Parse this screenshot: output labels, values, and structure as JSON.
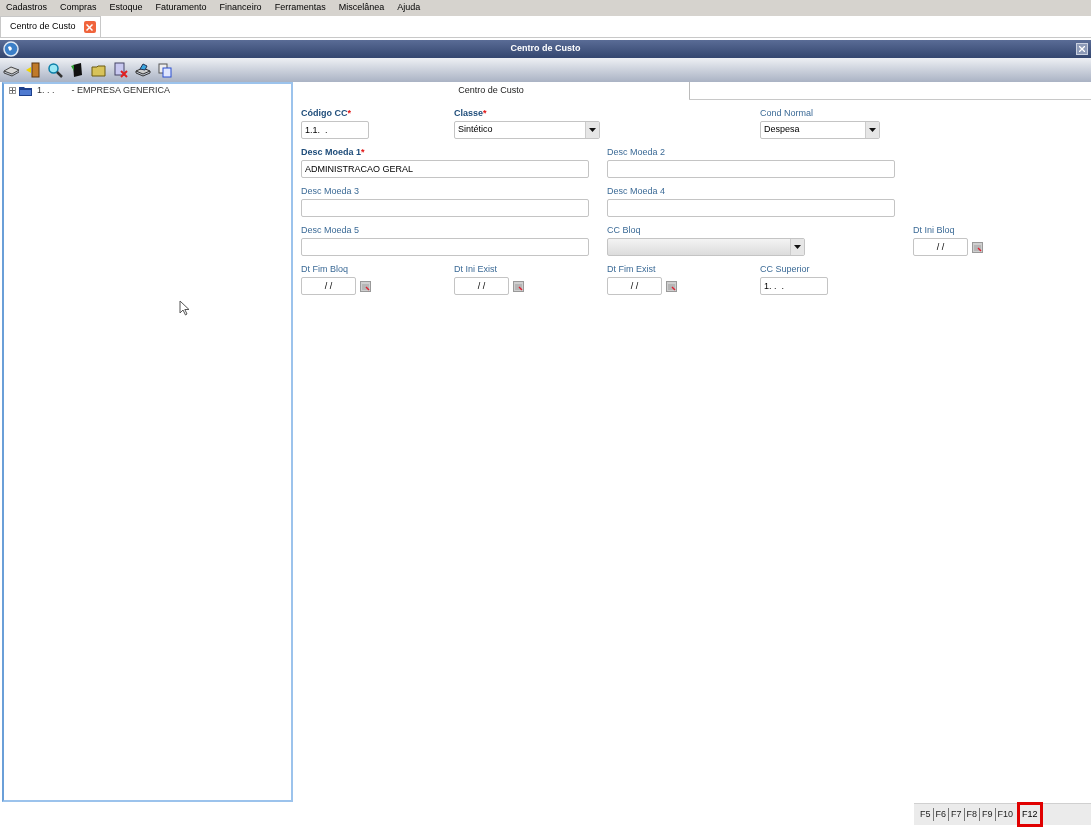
{
  "menu": [
    "Cadastros",
    "Compras",
    "Estoque",
    "Faturamento",
    "Financeiro",
    "Ferramentas",
    "Miscelânea",
    "Ajuda"
  ],
  "tabs": [
    {
      "label": "Centro de Custo",
      "selected": true
    }
  ],
  "window": {
    "title": "Centro de Custo"
  },
  "tree": [
    {
      "code": "1. . .",
      "name": "- EMPRESA GENERICA",
      "expanded": false
    }
  ],
  "form_tabs": [
    {
      "label": "Centro de Custo",
      "selected": true
    }
  ],
  "fields": [
    {
      "kind": "text",
      "label": "Código CC",
      "required": true,
      "mark": "*",
      "value": "1.1.  ."
    },
    {
      "kind": "select",
      "label": "Classe",
      "required": true,
      "mark": "*",
      "value": "Sintético"
    },
    {
      "kind": "select",
      "label": "Cond Normal",
      "required": false,
      "value": "Despesa"
    },
    {
      "kind": "text",
      "label": "Desc Moeda 1",
      "required": true,
      "mark": "*",
      "value": "ADMINISTRACAO GERAL"
    },
    {
      "kind": "text",
      "label": "Desc Moeda 2",
      "required": false
    },
    {
      "kind": "text",
      "label": "Desc Moeda 3",
      "required": false
    },
    {
      "kind": "text",
      "label": "Desc Moeda 4",
      "required": false
    },
    {
      "kind": "text",
      "label": "Desc Moeda 5",
      "required": false
    },
    {
      "kind": "select",
      "label": "CC Bloq",
      "required": false
    },
    {
      "kind": "date",
      "label": "Dt Ini Bloq",
      "required": false,
      "value": "/ /"
    },
    {
      "kind": "date",
      "label": "Dt Fim Bloq",
      "required": false,
      "value": "/ /"
    },
    {
      "kind": "date",
      "label": "Dt Ini Exist",
      "required": false,
      "value": "/ /"
    },
    {
      "kind": "date",
      "label": "Dt Fim Exist",
      "required": false,
      "value": "/ /"
    },
    {
      "kind": "text",
      "label": "CC Superior",
      "required": false,
      "value": "1. .  ."
    }
  ],
  "function_keys": [
    {
      "label": "F5",
      "highlighted": false
    },
    {
      "label": "F6",
      "highlighted": false
    },
    {
      "label": "F7",
      "highlighted": false
    },
    {
      "label": "F8",
      "highlighted": false
    },
    {
      "label": "F9",
      "highlighted": false
    },
    {
      "label": "F10",
      "highlighted": false
    },
    {
      "label": "F12",
      "highlighted": true
    }
  ]
}
